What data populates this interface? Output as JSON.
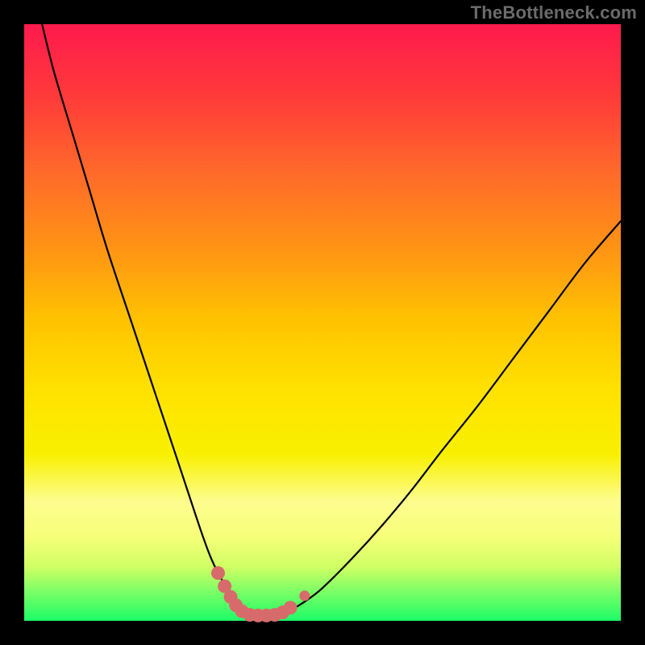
{
  "watermark": "TheBottleneck.com",
  "colors": {
    "curve_stroke": "#000000",
    "marker_fill": "#d76b6b",
    "background_frame": "#000000"
  },
  "chart_data": {
    "type": "line",
    "title": "",
    "xlabel": "",
    "ylabel": "",
    "xlim": [
      0,
      100
    ],
    "ylim": [
      0,
      100
    ],
    "grid": false,
    "legend": false,
    "series": [
      {
        "name": "bottleneck-curve",
        "x": [
          3,
          5,
          8,
          11,
          14,
          18,
          22,
          26,
          30,
          32,
          34,
          36,
          37,
          38,
          39,
          41,
          43,
          45,
          47,
          50,
          55,
          60,
          65,
          70,
          76,
          82,
          88,
          94,
          100
        ],
        "y": [
          100,
          92,
          82,
          72,
          62,
          50,
          38,
          26,
          14,
          9,
          5.5,
          3,
          1.8,
          1.2,
          1,
          1,
          1.2,
          2,
          3.2,
          5.5,
          10.5,
          16,
          22,
          28.5,
          36,
          44,
          52,
          60,
          67
        ],
        "_comment": "x is arbitrary horizontal 0-100, y is vertical percent where 0=bottom(green) 100=top(red)"
      }
    ],
    "markers": [
      {
        "x": 32.5,
        "y": 8.0
      },
      {
        "x": 33.6,
        "y": 5.8
      },
      {
        "x": 34.6,
        "y": 4.0
      },
      {
        "x": 35.5,
        "y": 2.6
      },
      {
        "x": 36.5,
        "y": 1.6
      },
      {
        "x": 37.8,
        "y": 1.0
      },
      {
        "x": 39.2,
        "y": 0.9
      },
      {
        "x": 40.6,
        "y": 0.9
      },
      {
        "x": 42.0,
        "y": 1.0
      },
      {
        "x": 43.3,
        "y": 1.4
      },
      {
        "x": 44.6,
        "y": 2.2
      },
      {
        "x": 47.0,
        "y": 4.2
      }
    ]
  }
}
